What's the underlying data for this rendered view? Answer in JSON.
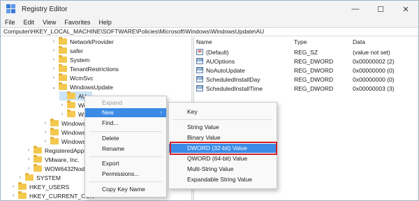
{
  "window": {
    "title": "Registry Editor",
    "minimize": "—",
    "maximize": "☐",
    "close": "✕"
  },
  "menu": [
    "File",
    "Edit",
    "View",
    "Favorites",
    "Help"
  ],
  "address": "Computer\\HKEY_LOCAL_MACHINE\\SOFTWARE\\Policies\\Microsoft\\Windows\\WindowsUpdate\\AU",
  "tree": [
    {
      "label": "NetworkProvider",
      "chev": "›"
    },
    {
      "label": "safer",
      "chev": "›"
    },
    {
      "label": "System",
      "chev": "›"
    },
    {
      "label": "TenantRestrictions",
      "chev": "›"
    },
    {
      "label": "WcmSvc",
      "chev": "›"
    },
    {
      "label": "WindowsUpdate",
      "chev": "⌄"
    },
    {
      "label": "AU",
      "chev": ""
    },
    {
      "label": "Workp",
      "chev": "›"
    },
    {
      "label": "WSDA",
      "chev": "›"
    },
    {
      "label": "Windows",
      "chev": "›"
    },
    {
      "label": "Windows",
      "chev": "›"
    },
    {
      "label": "Windows",
      "chev": "›"
    },
    {
      "label": "RegisteredAppl",
      "chev": "›"
    },
    {
      "label": "VMware, Inc.",
      "chev": "›"
    },
    {
      "label": "WOW6432Node",
      "chev": "›"
    },
    {
      "label": "SYSTEM",
      "chev": "›"
    },
    {
      "label": "HKEY_USERS",
      "chev": "›"
    },
    {
      "label": "HKEY_CURRENT_CON",
      "chev": "›"
    }
  ],
  "list": {
    "headers": {
      "name": "Name",
      "type": "Type",
      "data": "Data"
    },
    "rows": [
      {
        "icon": "ab",
        "name": "(Default)",
        "type": "REG_SZ",
        "data": "(value not set)"
      },
      {
        "icon": "010",
        "name": "AUOptions",
        "type": "REG_DWORD",
        "data": "0x00000002 (2)"
      },
      {
        "icon": "010",
        "name": "NoAutoUpdate",
        "type": "REG_DWORD",
        "data": "0x00000000 (0)"
      },
      {
        "icon": "010",
        "name": "ScheduledInstallDay",
        "type": "REG_DWORD",
        "data": "0x00000000 (0)"
      },
      {
        "icon": "010",
        "name": "ScheduledInstallTime",
        "type": "REG_DWORD",
        "data": "0x00000003 (3)"
      }
    ]
  },
  "context_menu": {
    "expand": "Expand",
    "new": "New",
    "new_arrow": "›",
    "find": "Find...",
    "delete": "Delete",
    "rename": "Rename",
    "export": "Export",
    "permissions": "Permissions...",
    "copy_key_name": "Copy Key Name"
  },
  "new_submenu": {
    "key": "Key",
    "string_value": "String Value",
    "binary_value": "Binary Value",
    "dword_value": "DWORD (32-bit) Value",
    "qword_value": "QWORD (64-bit) Value",
    "multi_string_value": "Multi-String Value",
    "expandable_string_value": "Expandable String Value"
  },
  "colors": {
    "highlight": "#3b8be6",
    "callout": "#d11f2a",
    "selected_tree": "#cce4f7"
  }
}
